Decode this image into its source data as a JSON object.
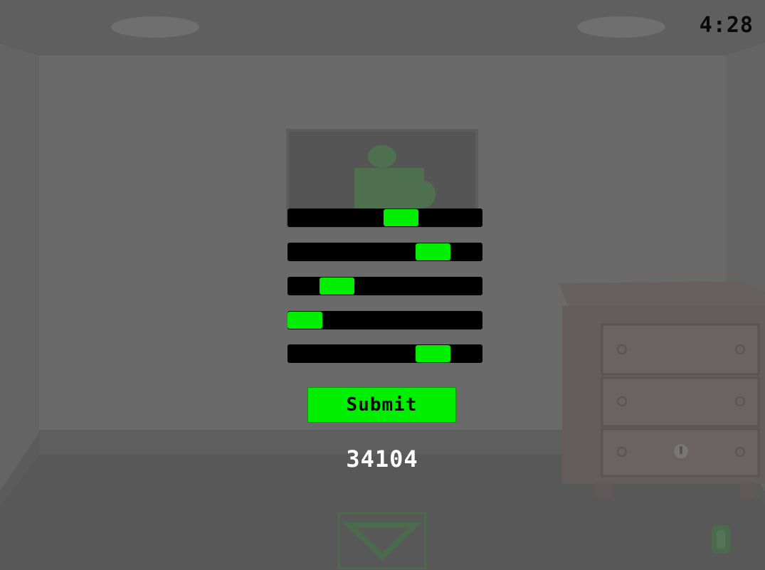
{
  "hud": {
    "timer": "4:28"
  },
  "puzzle": {
    "sliders": [
      {
        "name": "slider-1",
        "value": 0.6
      },
      {
        "name": "slider-2",
        "value": 0.8
      },
      {
        "name": "slider-3",
        "value": 0.2
      },
      {
        "name": "slider-4",
        "value": 0.0
      },
      {
        "name": "slider-5",
        "value": 0.8
      }
    ],
    "submit_label": "Submit",
    "code": "34104"
  },
  "colors": {
    "accent": "#00ee00",
    "slider_track": "#000000",
    "overlay": "#5a5a5a"
  },
  "icons": {
    "picture": "puzzle-piece-icon",
    "nav": "down-arrow-icon",
    "inventory": "item-icon"
  }
}
